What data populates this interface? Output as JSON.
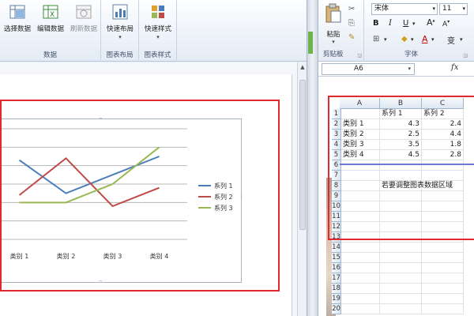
{
  "word": {
    "ribbon": {
      "data_group": {
        "label": "数据",
        "buttons": [
          {
            "label": "选择数据",
            "icon": "select-data-icon",
            "enabled": true
          },
          {
            "label": "编辑数据",
            "icon": "edit-data-icon",
            "enabled": true
          },
          {
            "label": "刷新数据",
            "icon": "refresh-data-icon",
            "enabled": false
          }
        ]
      },
      "layout_group": {
        "label": "图表布局",
        "button": "快速布局"
      },
      "styles_group": {
        "label": "图表样式",
        "button": "快速样式"
      }
    },
    "chart": {
      "chart_data": {
        "type": "line",
        "categories": [
          "类别 1",
          "类别 2",
          "类别 3",
          "类别 4"
        ],
        "series": [
          {
            "name": "系列 1",
            "color": "#4a7ebb",
            "values": [
              4.3,
              2.5,
              3.5,
              4.5
            ]
          },
          {
            "name": "系列 2",
            "color": "#be4b48",
            "values": [
              2.4,
              4.4,
              1.8,
              2.8
            ]
          },
          {
            "name": "系列 3",
            "color": "#98b954",
            "values": [
              2,
              2,
              3,
              5
            ]
          }
        ],
        "ylim": [
          0,
          6
        ],
        "grid": true,
        "legend": "right"
      }
    }
  },
  "excel": {
    "ribbon": {
      "paste_label": "粘贴",
      "clipboard_label": "剪贴板",
      "font_name": "宋体",
      "font_size": "11",
      "font_group_label": "字体",
      "bold": "B",
      "italic": "I",
      "underline": "U",
      "grow_font": "A",
      "shrink_font": "A",
      "font_color": "A",
      "phonetic": "变"
    },
    "name_box": "A6",
    "fx": "fx",
    "columns": [
      "A",
      "B",
      "C"
    ],
    "rows": [
      "1",
      "2",
      "3",
      "4",
      "5",
      "6",
      "7",
      "8",
      "9",
      "10",
      "11",
      "12",
      "13",
      "14",
      "15",
      "16",
      "17",
      "18",
      "19",
      "20"
    ],
    "headers": [
      "",
      "系列 1",
      "系列 2"
    ],
    "data": [
      [
        "类别 1",
        "4.3",
        "2.4"
      ],
      [
        "类别 2",
        "2.5",
        "4.4"
      ],
      [
        "类别 3",
        "3.5",
        "1.8"
      ],
      [
        "类别 4",
        "4.5",
        "2.8"
      ]
    ],
    "note": "若要调整图表数据区域"
  }
}
